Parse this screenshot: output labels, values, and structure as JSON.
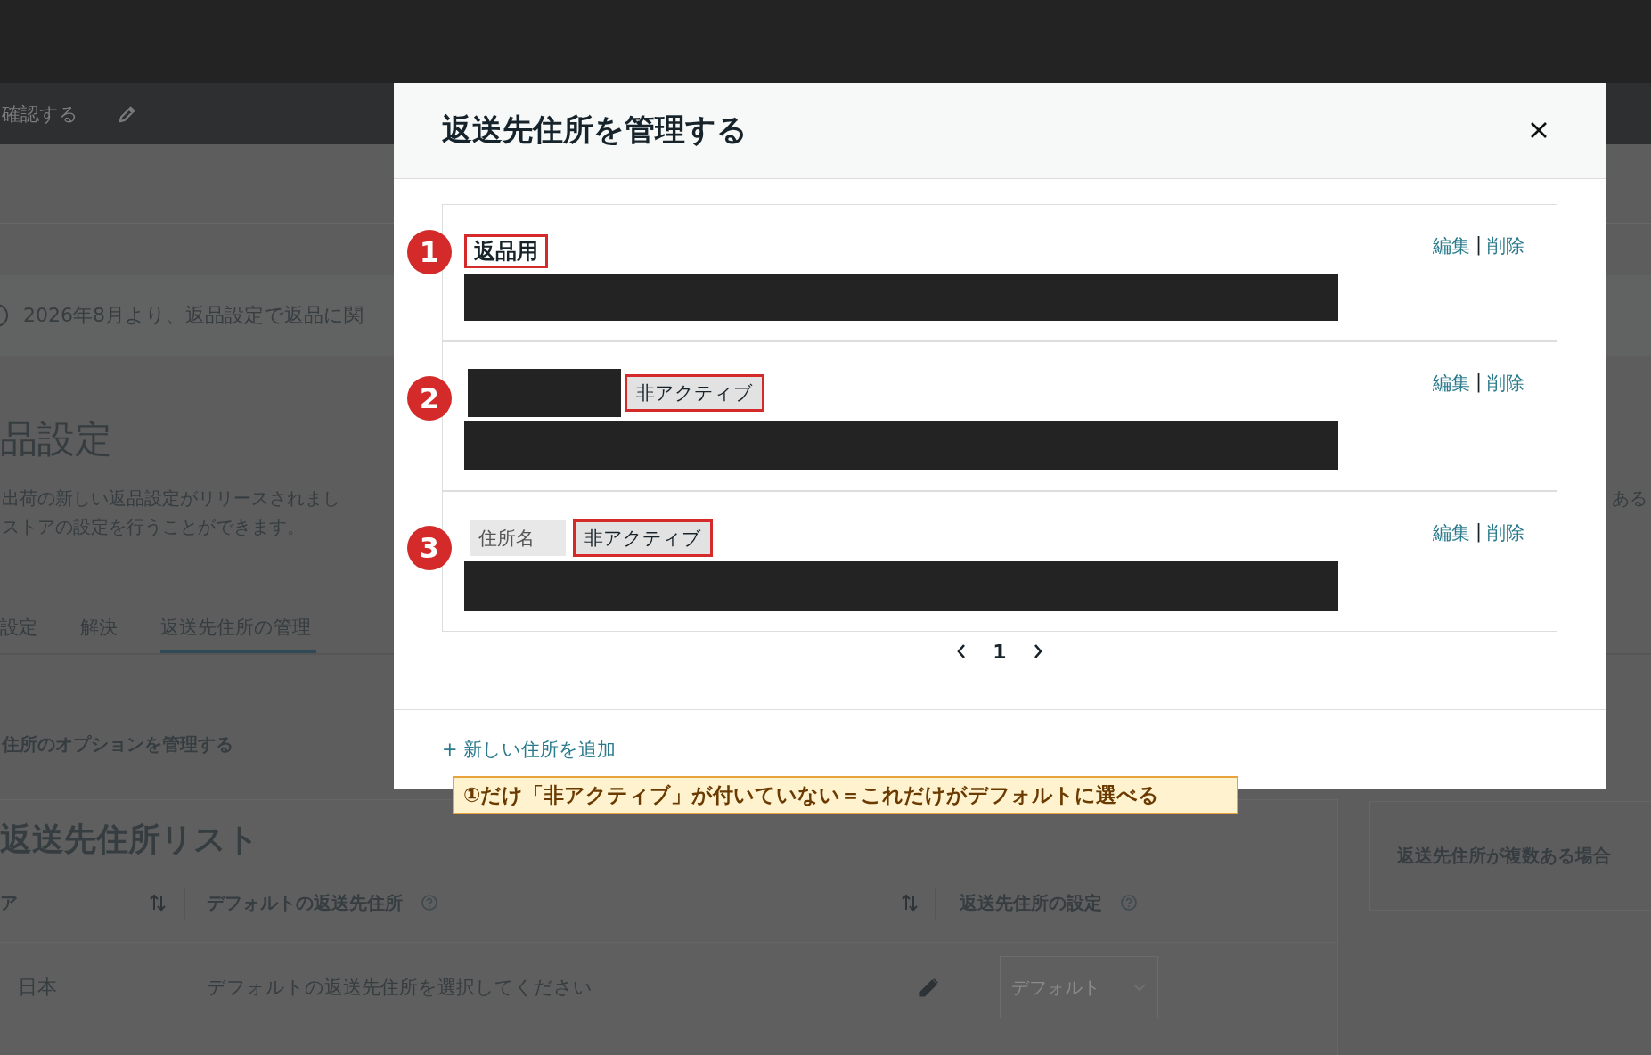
{
  "top_bar": {
    "action": "確認する"
  },
  "notice": {
    "text": "2026年8月より、返品設定で返品に関"
  },
  "page": {
    "title": "品設定",
    "description": [
      "出荷の新しい返品設定がリリースされまし",
      "ストアの設定を行うことができます。"
    ],
    "description_right": "ある"
  },
  "tabs": [
    {
      "label": "設定",
      "selected": false
    },
    {
      "label": "解決",
      "selected": false
    },
    {
      "label": "返送先住所の管理",
      "selected": true
    }
  ],
  "section_title": "住所のオプションを管理する",
  "list_card": {
    "title": "返送先住所リスト",
    "columns": [
      {
        "label": "ア",
        "sortable": true,
        "help": false
      },
      {
        "label": "デフォルトの返送先住所",
        "sortable": true,
        "help": true
      },
      {
        "label": "返送先住所の設定",
        "sortable": false,
        "help": true
      }
    ],
    "rows": [
      {
        "region": "日本",
        "default_address": "デフォルトの返送先住所を選択してください",
        "setting": "デフォルト",
        "setting_disabled": true
      }
    ]
  },
  "side_card": {
    "title": "返送先住所が複数ある場合"
  },
  "modal": {
    "title": "返送先住所を管理する",
    "addresses": [
      {
        "marker": "1",
        "name": {
          "kind": "label",
          "text": "返品用"
        },
        "highlighted": true,
        "edit": "編集",
        "separator": "|",
        "delete": "削除"
      },
      {
        "marker": "2",
        "name": {
          "kind": "redacted"
        },
        "badge": "非アクティブ",
        "highlighted": true,
        "edit": "編集",
        "separator": "|",
        "delete": "削除"
      },
      {
        "marker": "3",
        "name": {
          "kind": "chip",
          "text": "住所名"
        },
        "badge": "非アクティブ",
        "highlighted": true,
        "edit": "編集",
        "separator": "|",
        "delete": "削除"
      }
    ],
    "pagination": {
      "page": "1"
    },
    "add_link": "+ 新しい住所を追加"
  },
  "callout": "①だけ「非アクティブ」が付いていない＝これだけがデフォルトに選べる"
}
